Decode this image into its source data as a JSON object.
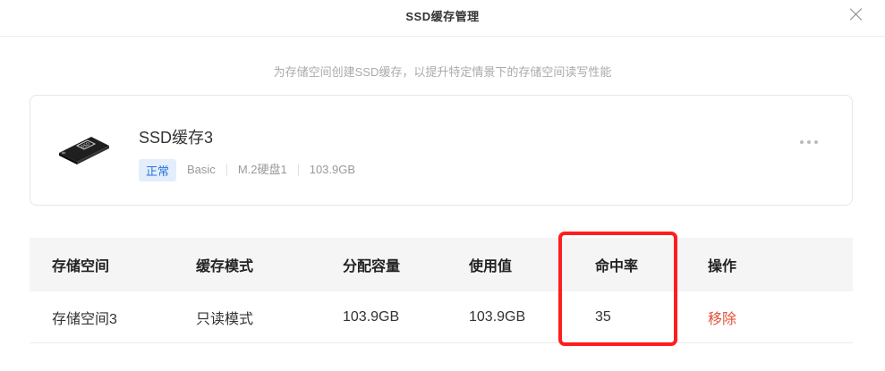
{
  "dialog": {
    "title": "SSD缓存管理"
  },
  "subtitle": "为存储空间创建SSD缓存，以提升特定情景下的存储空间读写性能",
  "cache": {
    "name": "SSD缓存3",
    "status": "正常",
    "mode": "Basic",
    "disk": "M.2硬盘1",
    "size": "103.9GB",
    "icon": "ssd-icon",
    "status_color": "#2b71d8"
  },
  "table": {
    "headers": [
      "存储空间",
      "缓存模式",
      "分配容量",
      "使用值",
      "命中率",
      "操作"
    ],
    "rows": [
      {
        "space": "存储空间3",
        "mode": "只读模式",
        "allocated": "103.9GB",
        "used": "103.9GB",
        "hit_rate": "35",
        "action": "移除"
      }
    ]
  },
  "colors": {
    "action": "#e0533b",
    "highlight": "#ff1d1d"
  }
}
